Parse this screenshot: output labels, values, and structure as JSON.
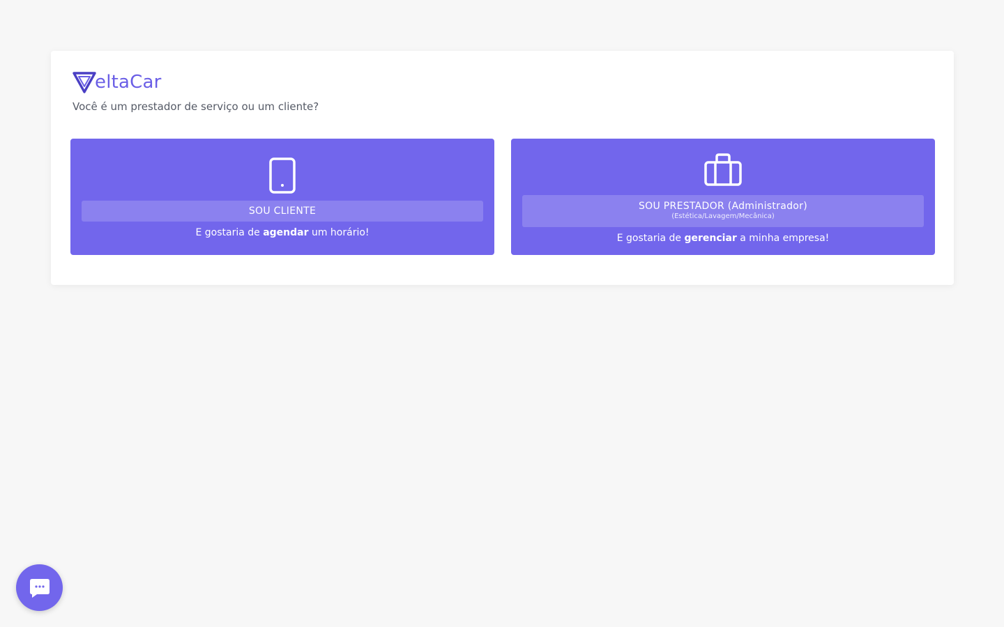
{
  "brand": {
    "name": "eltaCar",
    "logo_icon": "v-triangle-logo-icon",
    "accent_color": "#6a5ee6"
  },
  "question": "Você é um prestador de serviço ou um cliente?",
  "options": {
    "client": {
      "icon": "smartphone-icon",
      "label": "SOU CLIENTE",
      "tagline_pre": "E gostaria de ",
      "tagline_bold": "agendar",
      "tagline_post": " um horário!"
    },
    "provider": {
      "icon": "briefcase-icon",
      "label": "SOU PRESTADOR (Administrador)",
      "sublabel": "(Estética/Lavagem/Mecânica)",
      "tagline_pre": "E gostaria de ",
      "tagline_bold": "gerenciar",
      "tagline_post": " a minha empresa!"
    },
    "background_color": "#7266ec"
  },
  "chat": {
    "icon": "chat-bubble-icon"
  }
}
